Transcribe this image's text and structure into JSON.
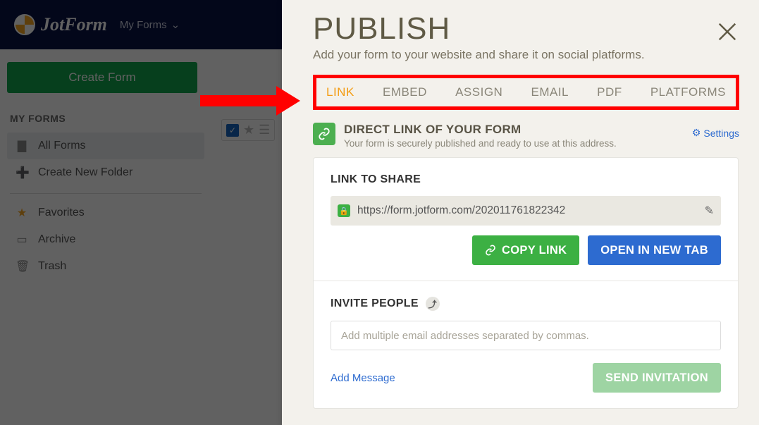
{
  "topbar": {
    "brand": "JotForm",
    "menu_label": "My Forms"
  },
  "sidebar": {
    "create_label": "Create Form",
    "heading": "MY FORMS",
    "items": [
      {
        "label": "All Forms"
      },
      {
        "label": "Create New Folder"
      },
      {
        "label": "Favorites"
      },
      {
        "label": "Archive"
      },
      {
        "label": "Trash"
      }
    ]
  },
  "publish": {
    "title": "PUBLISH",
    "subtitle": "Add your form to your website and share it on social platforms.",
    "tabs": {
      "link": "LINK",
      "embed": "EMBED",
      "assign": "ASSIGN",
      "email": "EMAIL",
      "pdf": "PDF",
      "platforms": "PLATFORMS"
    },
    "direct": {
      "title": "DIRECT LINK OF YOUR FORM",
      "sub": "Your form is securely published and ready to use at this address.",
      "settings": "Settings"
    },
    "share": {
      "heading": "LINK TO SHARE",
      "url": "https://form.jotform.com/202011761822342",
      "copy_btn": "COPY LINK",
      "open_btn": "OPEN IN NEW TAB"
    },
    "invite": {
      "heading": "INVITE PEOPLE",
      "placeholder": "Add multiple email addresses separated by commas.",
      "add_message": "Add Message",
      "send_btn": "SEND INVITATION"
    }
  }
}
